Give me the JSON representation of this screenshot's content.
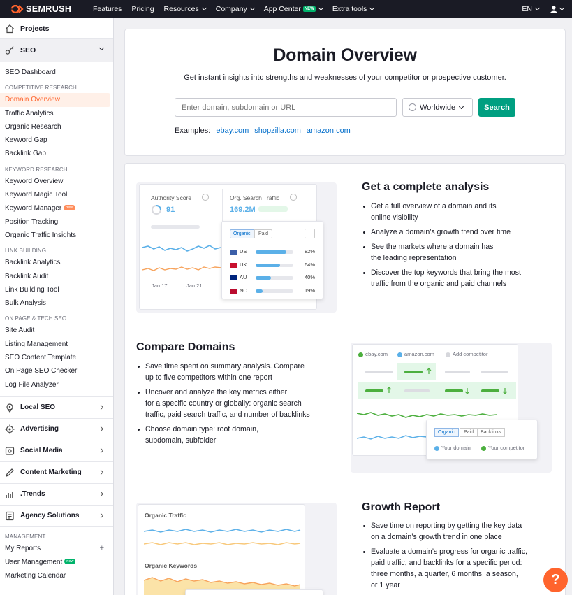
{
  "topbar": {
    "logo": "SEMRUSH",
    "nav": [
      {
        "label": "Features",
        "chev": false
      },
      {
        "label": "Pricing",
        "chev": false
      },
      {
        "label": "Resources",
        "chev": true
      },
      {
        "label": "Company",
        "chev": true
      },
      {
        "label": "App Center",
        "chev": true,
        "badge": "NEW"
      },
      {
        "label": "Extra tools",
        "chev": true
      }
    ],
    "lang": "EN"
  },
  "sidebar": {
    "projects": "Projects",
    "seo": "SEO",
    "dashboard": "SEO Dashboard",
    "competitive": {
      "title": "COMPETITIVE RESEARCH",
      "items": [
        "Domain Overview",
        "Traffic Analytics",
        "Organic Research",
        "Keyword Gap",
        "Backlink Gap"
      ]
    },
    "keyword": {
      "title": "KEYWORD RESEARCH",
      "items": [
        "Keyword Overview",
        "Keyword Magic Tool",
        "Keyword Manager",
        "Position Tracking",
        "Organic Traffic Insights"
      ],
      "beta": "beta"
    },
    "link": {
      "title": "LINK BUILDING",
      "items": [
        "Backlink Analytics",
        "Backlink Audit",
        "Link Building Tool",
        "Bulk Analysis"
      ]
    },
    "onpage": {
      "title": "ON PAGE & TECH SEO",
      "items": [
        "Site Audit",
        "Listing Management",
        "SEO Content Template",
        "On Page SEO Checker",
        "Log File Analyzer"
      ]
    },
    "groups": [
      "Local SEO",
      "Advertising",
      "Social Media",
      "Content Marketing",
      ".Trends",
      "Agency Solutions"
    ],
    "management": {
      "title": "MANAGEMENT",
      "items": [
        "My Reports",
        "User Management",
        "Marketing Calendar"
      ],
      "new": "new"
    }
  },
  "hero": {
    "title": "Domain Overview",
    "subtitle": "Get instant insights into strengths and weaknesses of your competitor or prospective customer.",
    "search_placeholder": "Enter domain, subdomain or URL",
    "region": "Worldwide",
    "search_button": "Search",
    "examples_label": "Examples:",
    "examples": [
      "ebay.com",
      "shopzilla.com",
      "amazon.com"
    ]
  },
  "feature1": {
    "title": "Get a complete analysis",
    "bullets": [
      [
        "Get a full overview of a domain and its",
        "online visibility"
      ],
      [
        "Analyze a domain’s growth trend over time"
      ],
      [
        "See the markets where a domain has",
        "the leading representation"
      ],
      [
        "Discover the top keywords that bring the most",
        "traffic from the organic and paid channels"
      ]
    ],
    "authority_label": "Authority Score",
    "authority_value": "91",
    "traffic_label": "Org. Search Traffic",
    "traffic_value": "169.2M",
    "dates": [
      "Jan 17",
      "Jan 21"
    ],
    "tabs": [
      "Organic",
      "Paid"
    ],
    "countries": [
      {
        "code": "US",
        "pct": "82%",
        "fill": 0.82
      },
      {
        "code": "UK",
        "pct": "64%",
        "fill": 0.64
      },
      {
        "code": "AU",
        "pct": "40%",
        "fill": 0.4
      },
      {
        "code": "NO",
        "pct": "19%",
        "fill": 0.19
      }
    ]
  },
  "feature2": {
    "title": "Compare Domains",
    "bullets": [
      [
        "Save time spent on summary analysis. Compare",
        "up to five competitors within one report"
      ],
      [
        "Uncover and analyze the key metrics either",
        "for a specific country or globally: organic search",
        "traffic, paid search traffic, and number of backlinks"
      ],
      [
        "Choose domain type: root domain,",
        "subdomain, subfolder"
      ]
    ],
    "legend": [
      "ebay.com",
      "amazon.com",
      "Add competitor"
    ],
    "tabs": [
      "Organic",
      "Paid",
      "Backlinks"
    ],
    "domains": [
      "Your domain",
      "Your competitor"
    ]
  },
  "feature3": {
    "title": "Growth Report",
    "bullets": [
      [
        "Save time on reporting by getting the key data",
        "on a domain’s growth trend in one place"
      ],
      [
        "Evaluate a domain’s progress for organic traffic,",
        "paid traffic, and backlinks for a specific period:",
        "three months, a quarter, 6 months, a season,",
        "or 1 year"
      ]
    ],
    "chart_labels": [
      "Organic Traffic",
      "Organic Keywords"
    ]
  },
  "help": "?",
  "colors": {
    "accent": "#ff642d",
    "search": "#009f81",
    "link": "#006dca",
    "blue": "#5bb0e8",
    "orange": "#f7a35c",
    "green": "#4caf3e"
  }
}
